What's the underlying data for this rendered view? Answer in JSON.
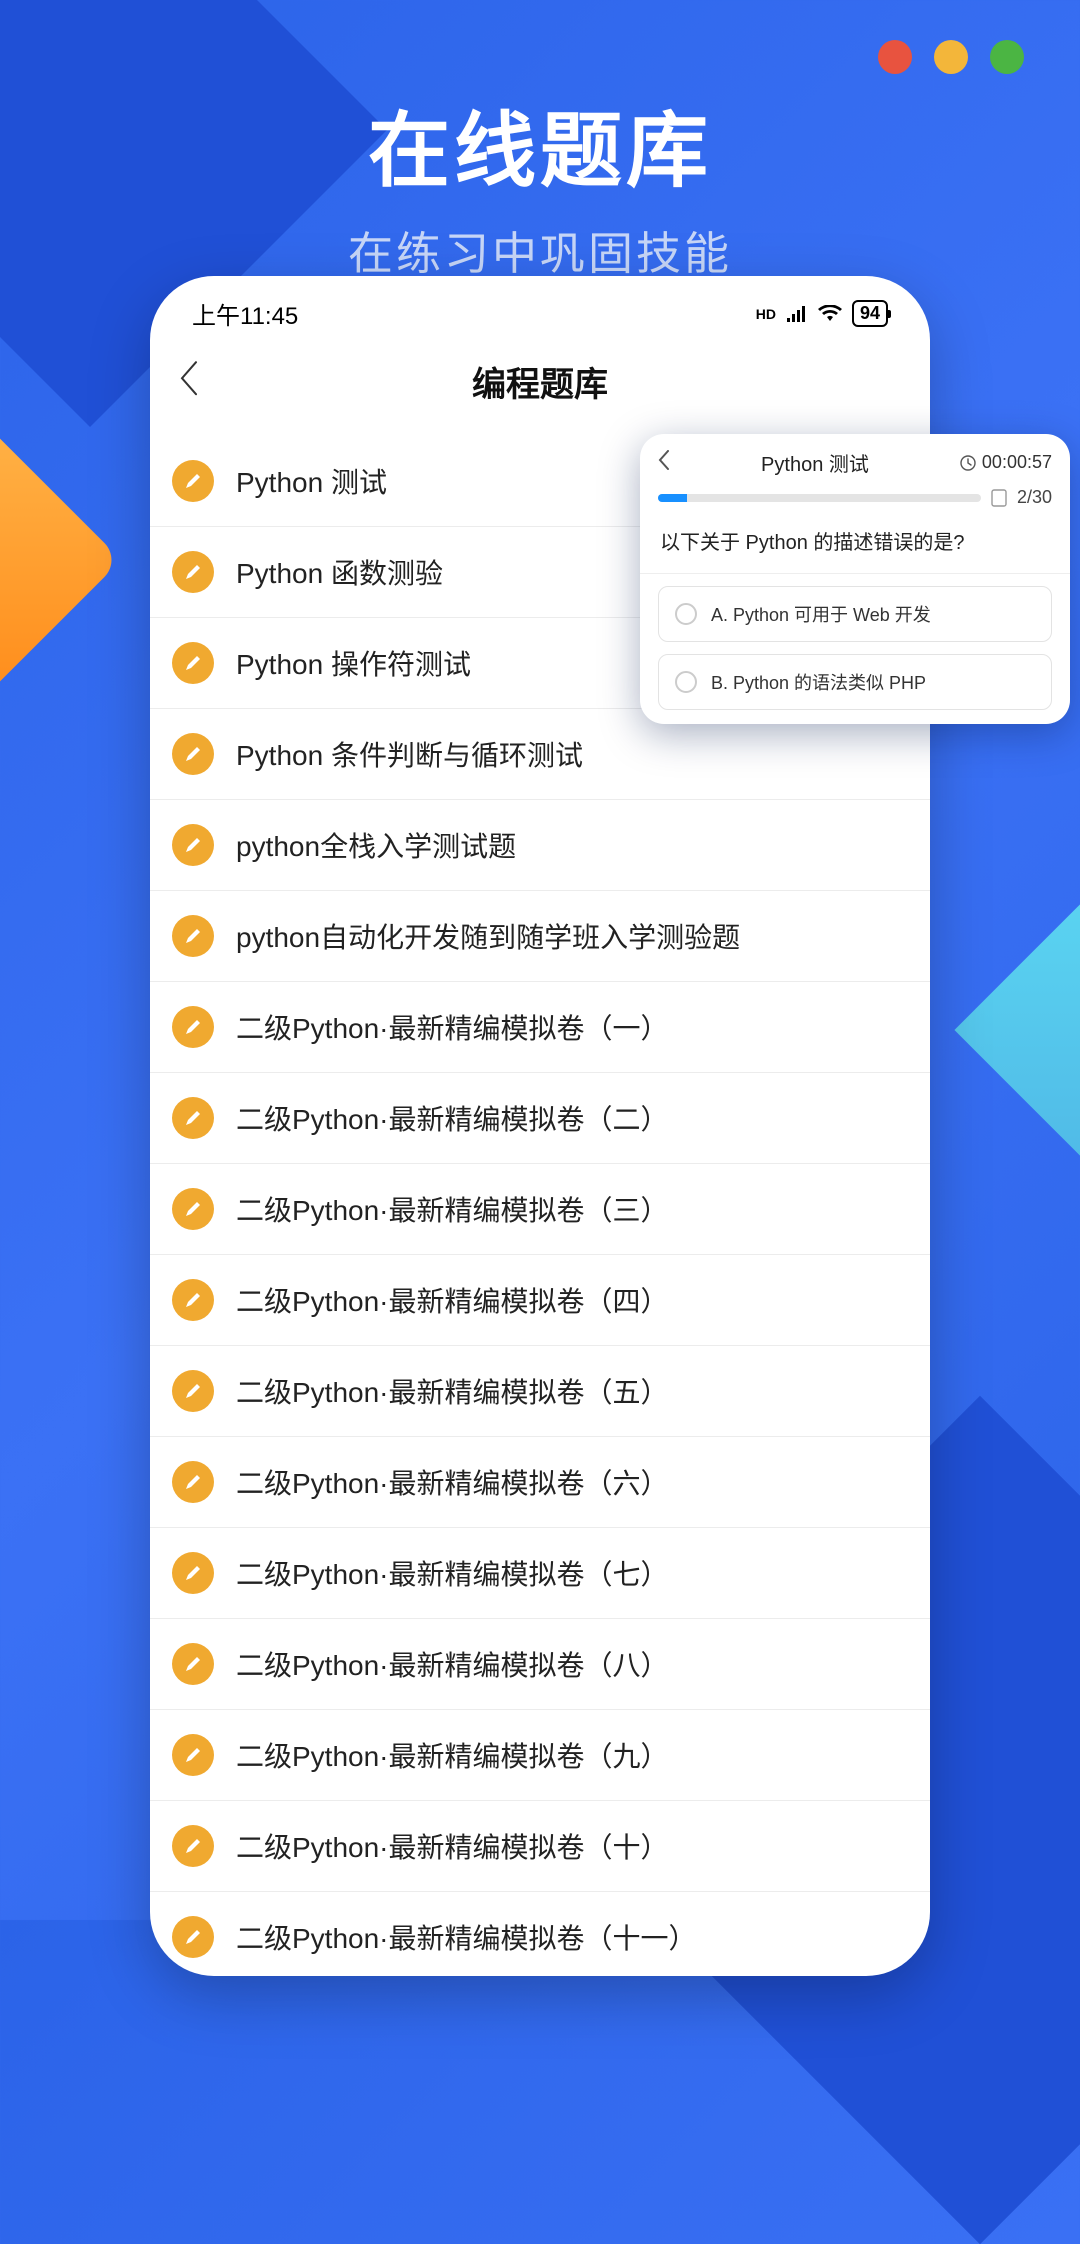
{
  "hero": {
    "title": "在线题库",
    "subtitle": "在练习中巩固技能"
  },
  "status_bar": {
    "time": "上午11:45",
    "hd_label": "HD",
    "battery": "94"
  },
  "nav": {
    "title": "编程题库"
  },
  "list": {
    "items": [
      {
        "label": "Python 测试"
      },
      {
        "label": "Python 函数测验"
      },
      {
        "label": "Python 操作符测试"
      },
      {
        "label": "Python 条件判断与循环测试"
      },
      {
        "label": "python全栈入学测试题"
      },
      {
        "label": "python自动化开发随到随学班入学测验题"
      },
      {
        "label": "二级Python·最新精编模拟卷（一）"
      },
      {
        "label": "二级Python·最新精编模拟卷（二）"
      },
      {
        "label": "二级Python·最新精编模拟卷（三）"
      },
      {
        "label": "二级Python·最新精编模拟卷（四）"
      },
      {
        "label": "二级Python·最新精编模拟卷（五）"
      },
      {
        "label": "二级Python·最新精编模拟卷（六）"
      },
      {
        "label": "二级Python·最新精编模拟卷（七）"
      },
      {
        "label": "二级Python·最新精编模拟卷（八）"
      },
      {
        "label": "二级Python·最新精编模拟卷（九）"
      },
      {
        "label": "二级Python·最新精编模拟卷（十）"
      },
      {
        "label": "二级Python·最新精编模拟卷（十一）"
      }
    ]
  },
  "quiz": {
    "title": "Python 测试",
    "timer": "00:00:57",
    "progress": "2/30",
    "question": "以下关于 Python 的描述错误的是?",
    "options": [
      {
        "text": "A. Python 可用于 Web 开发"
      },
      {
        "text": "B. Python 的语法类似 PHP"
      }
    ]
  }
}
